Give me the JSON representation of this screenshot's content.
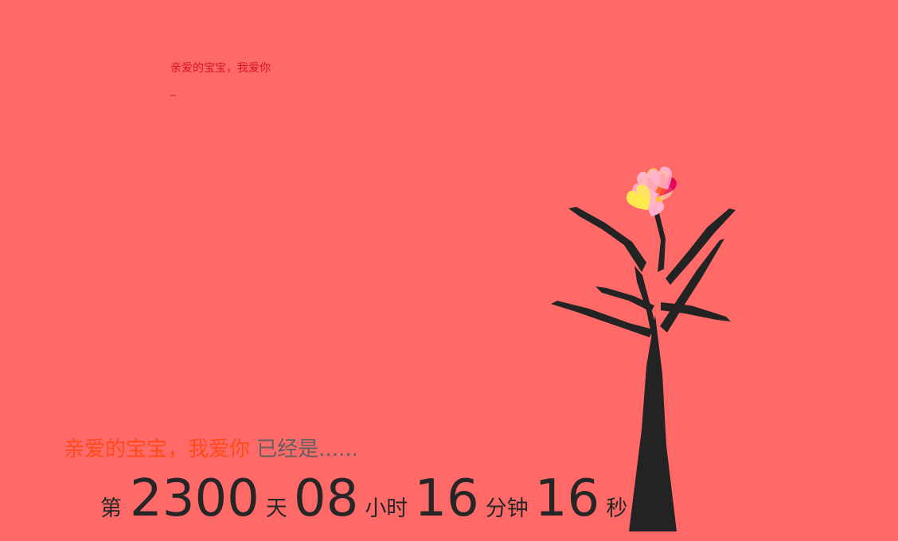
{
  "typed_text": "亲爱的宝宝，我爱你",
  "typed_cursor": "_",
  "love_line": {
    "love": "亲爱的宝宝，我爱你",
    "already": "已经是......"
  },
  "counter": {
    "prefix": "第",
    "days": "2300",
    "days_unit": "天",
    "hours": "08",
    "hours_unit": "小时",
    "minutes": "16",
    "minutes_unit": "分钟",
    "seconds": "16",
    "seconds_unit": "秒"
  },
  "colors": {
    "background": "#ff6a69",
    "trunk": "#232323",
    "love_text": "#ff4a1a",
    "already_text": "#5f5f5f",
    "counter_text": "#262626",
    "typed_text": "#d8141c",
    "heart_palette": [
      "#ff1a4a",
      "#ff4fc4",
      "#ff8ad3",
      "#ffd32a",
      "#fff04a",
      "#ff9b3d",
      "#ffb3d1",
      "#e2005b",
      "#ff5a1f",
      "#ffc2a2"
    ]
  },
  "illustration": {
    "name": "heart-shaped-tree"
  }
}
